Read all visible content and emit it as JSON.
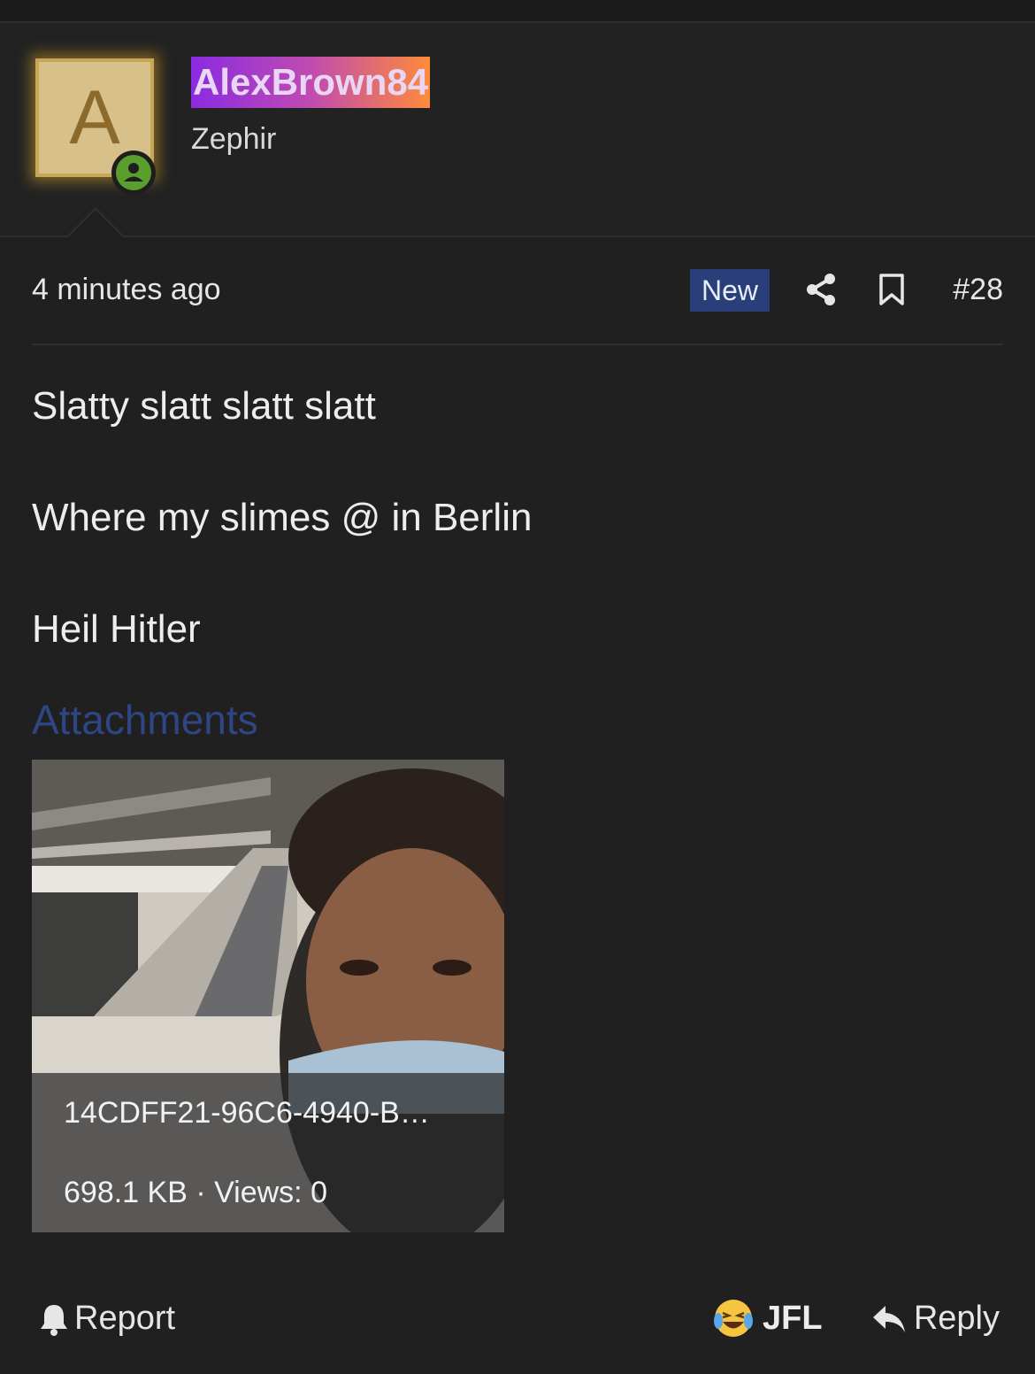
{
  "user": {
    "avatar_letter": "A",
    "username": "AlexBrown84",
    "title": "Zephir",
    "online_status": "online"
  },
  "post": {
    "timestamp": "4 minutes ago",
    "badge": "New",
    "number": "#28",
    "lines": [
      "Slatty slatt slatt slatt",
      "Where my slimes @ in Berlin",
      "Heil Hitler"
    ]
  },
  "attachments": {
    "heading": "Attachments",
    "items": [
      {
        "filename": "14CDFF21-96C6-4940-B…",
        "meta": "698.1 KB · Views: 0"
      }
    ]
  },
  "actions": {
    "report_label": "Report",
    "reaction_label": "JFL",
    "reply_label": "Reply"
  },
  "colors": {
    "background": "#202020",
    "accent_link": "#2f4584",
    "new_badge": "#2a3f7a",
    "online": "#5a9e2e",
    "username_gradient": [
      "#8a2be2",
      "#ff8a3a"
    ]
  },
  "icons": [
    "online-user-icon",
    "share-icon",
    "bookmark-icon",
    "bell-icon",
    "laughing-crying-emoji-icon",
    "reply-arrow-icon"
  ]
}
